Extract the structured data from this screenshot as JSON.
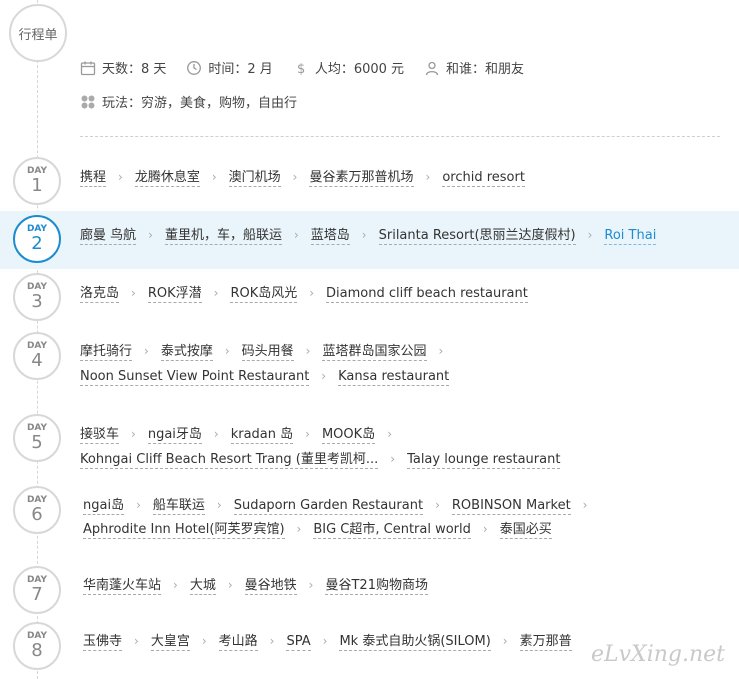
{
  "header": {
    "title": "行程单"
  },
  "summary": {
    "days": "天数：8 天",
    "time": "时间：2 月",
    "cost": "人均：6000 元",
    "with": "和谁：和朋友",
    "play": "玩法：穷游，美食，购物，自由行"
  },
  "days": [
    {
      "label": "DAY",
      "num": "1",
      "lines": [
        [
          "携程",
          "龙腾休息室",
          "澳门机场",
          "曼谷素万那普机场",
          "orchid resort"
        ]
      ]
    },
    {
      "label": "DAY",
      "num": "2",
      "lines": [
        [
          "廊曼 鸟航",
          "董里机，车，船联运",
          "蓝塔岛",
          "Srilanta Resort(思丽兰达度假村)",
          "Roi Thai"
        ]
      ]
    },
    {
      "label": "DAY",
      "num": "3",
      "lines": [
        [
          "洛克岛",
          "ROK浮潜",
          "ROK岛风光",
          "Diamond cliff beach restaurant"
        ]
      ]
    },
    {
      "label": "DAY",
      "num": "4",
      "lines": [
        [
          "摩托骑行",
          "泰式按摩",
          "码头用餐",
          "蓝塔群岛国家公园",
          ""
        ],
        [
          "Noon Sunset View Point Restaurant",
          "Kansa restaurant"
        ]
      ]
    },
    {
      "label": "DAY",
      "num": "5",
      "lines": [
        [
          "接驳车",
          "ngai牙岛",
          "kradan 岛",
          "MOOK岛",
          ""
        ],
        [
          "Kohngai Cliff Beach Resort Trang (董里考凯柯...",
          "Talay lounge restaurant"
        ]
      ]
    },
    {
      "label": "DAY",
      "num": "6",
      "lines": [
        [
          "ngai岛",
          "船车联运",
          "Sudaporn Garden Restaurant",
          "ROBINSON Market",
          ""
        ],
        [
          "Aphrodite Inn Hotel(阿芙罗宾馆)",
          "BIG C超市, Central world",
          "泰国必买"
        ]
      ]
    },
    {
      "label": "DAY",
      "num": "7",
      "lines": [
        [
          "华南蓬火车站",
          "大城",
          "曼谷地铁",
          "曼谷T21购物商场"
        ]
      ]
    },
    {
      "label": "DAY",
      "num": "8",
      "lines": [
        [
          "玉佛寺",
          "大皇宫",
          "考山路",
          "SPA",
          "Mk 泰式自助火锅(SILOM)",
          "素万那普"
        ]
      ]
    }
  ],
  "watermark": "eLvXing.net"
}
